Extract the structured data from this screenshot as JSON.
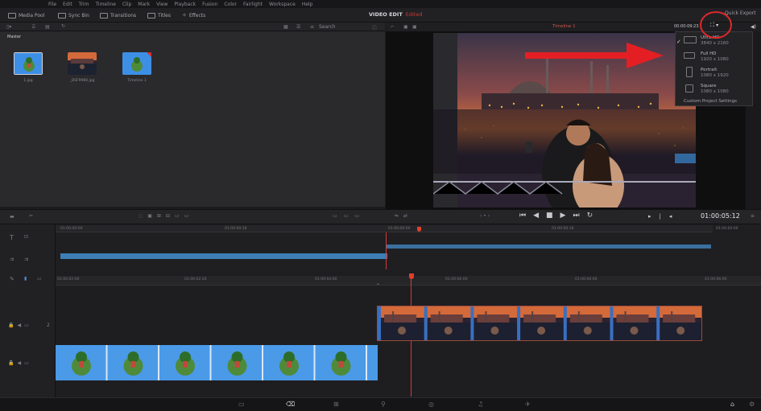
{
  "menu": [
    "File",
    "Edit",
    "Trim",
    "Timeline",
    "Clip",
    "Mark",
    "View",
    "Playback",
    "Fusion",
    "Color",
    "Fairlight",
    "Workspace",
    "Help"
  ],
  "toolbar": {
    "media_pool": "Media Pool",
    "sync_bin": "Sync Bin",
    "transitions": "Transitions",
    "titles": "Titles",
    "effects": "Effects",
    "page_title": "VIDEO EDIT",
    "edited": "Edited",
    "quick_export": "Quick Export"
  },
  "pool": {
    "search_placeholder": "Search",
    "bin": "Master",
    "items": [
      {
        "label": "1.jpg"
      },
      {
        "label": "_DSF9980.jpg"
      },
      {
        "label": "Timeline 1"
      }
    ]
  },
  "viewer": {
    "timeline_name": "Timeline 1",
    "timecode_top": "00:00:09:23",
    "timecode": "01:00:05:12"
  },
  "resolution_menu": {
    "items": [
      {
        "name": "Ultra HD",
        "size": "3840 x 2160",
        "checked": true
      },
      {
        "name": "Full HD",
        "size": "1920 x 1080",
        "checked": false
      },
      {
        "name": "Portrait",
        "size": "1080 x 1920",
        "checked": false
      },
      {
        "name": "Square",
        "size": "1080 x 1080",
        "checked": false
      }
    ],
    "custom": "Custom Project Settings"
  },
  "timeline": {
    "ruler_upper": [
      "01:00:00:00",
      "01:00:00:16",
      "01:00:00:00",
      "01:00:00:16",
      "01:00:00:00"
    ],
    "ruler_lower": [
      "01:00:02:00",
      "01:00:02:20",
      "01:00:04:00",
      "01:00:06:00",
      "01:00:06:00",
      "01:00:06:00"
    ],
    "tracks": [
      {
        "number": "2"
      },
      {
        "number": "1"
      }
    ]
  },
  "colors": {
    "accent": "#e0282a",
    "timeline_clip": "#3d7fb5",
    "playhead": "#d23a3a"
  }
}
